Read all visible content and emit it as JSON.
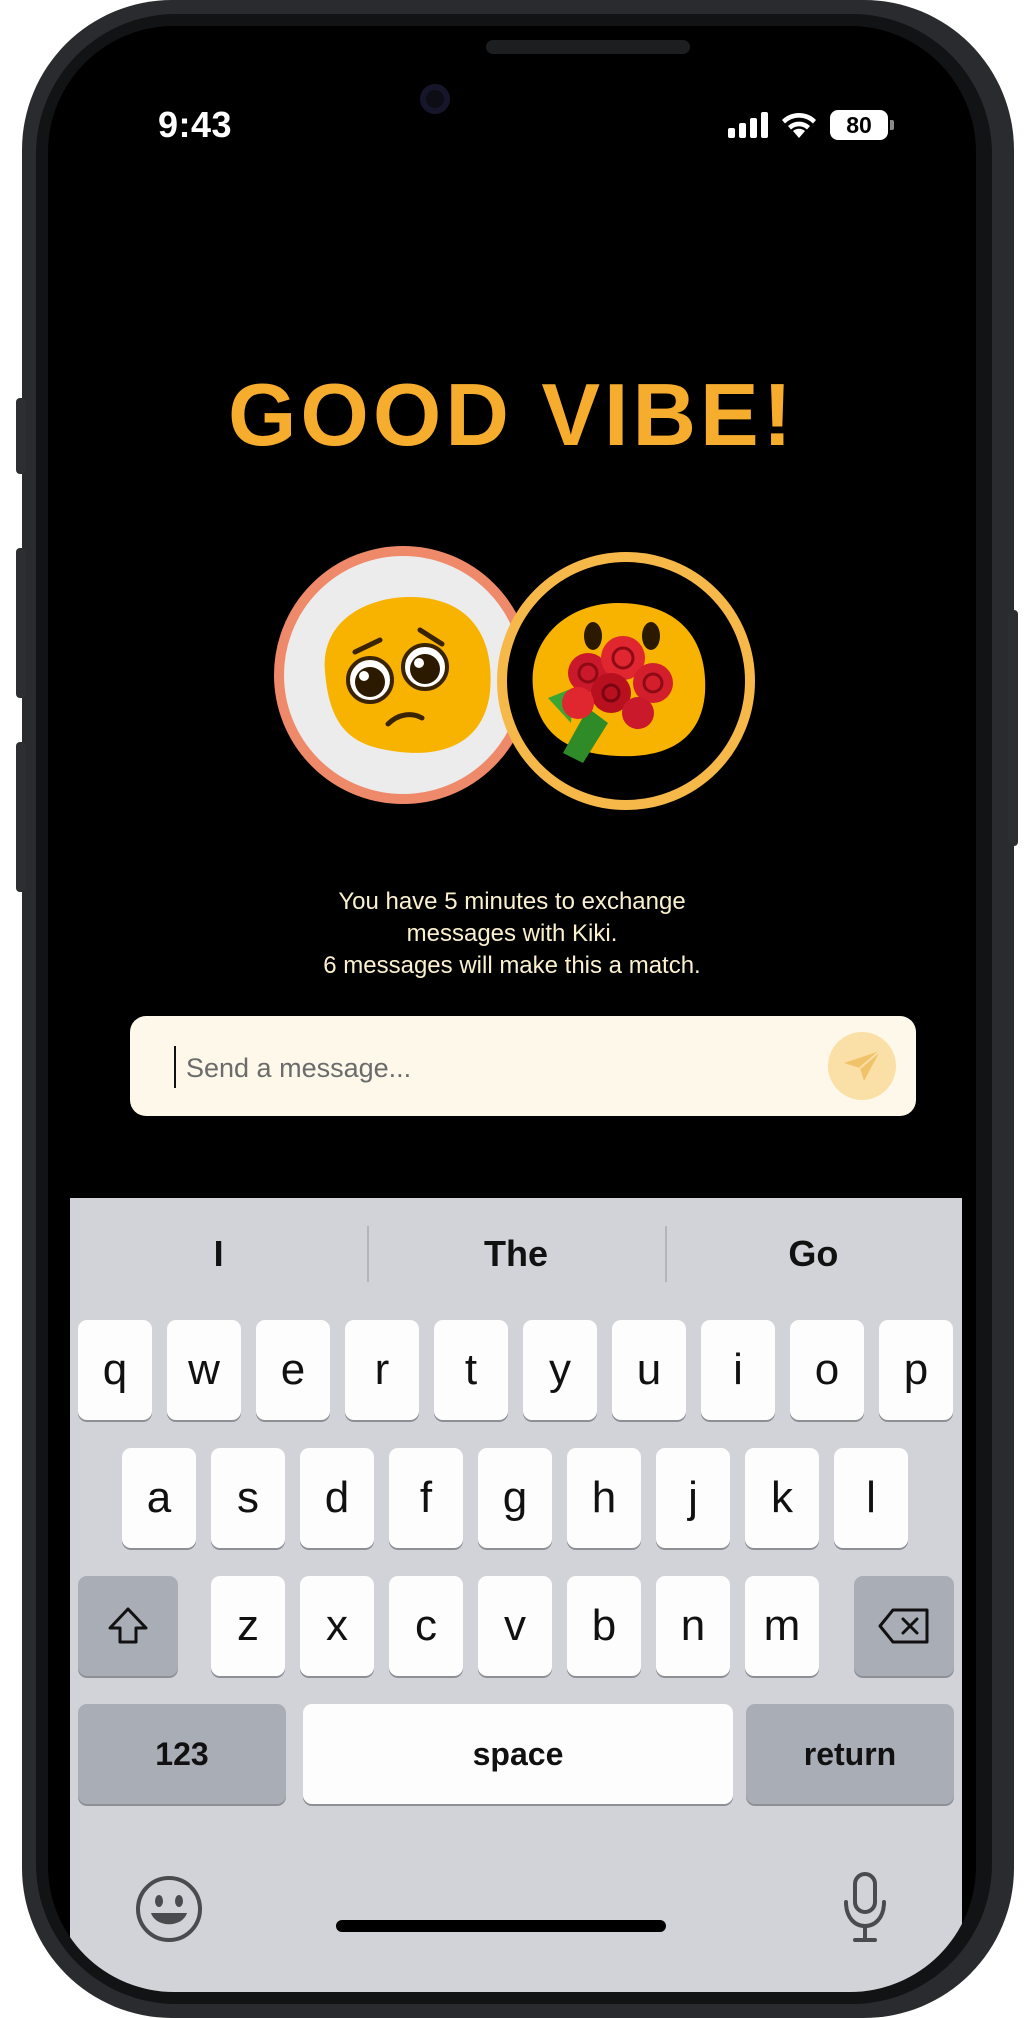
{
  "status_bar": {
    "time": "9:43",
    "battery": "80"
  },
  "screen": {
    "headline": "GOOD VIBE!",
    "info_lines": [
      "You have 5 minutes to exchange",
      "messages with Kiki.",
      "6 messages will make this a match."
    ],
    "composer": {
      "placeholder": "Send a message..."
    }
  },
  "keyboard": {
    "suggestions": [
      "I",
      "The",
      "Go"
    ],
    "row1": [
      "q",
      "w",
      "e",
      "r",
      "t",
      "y",
      "u",
      "i",
      "o",
      "p"
    ],
    "row2": [
      "a",
      "s",
      "d",
      "f",
      "g",
      "h",
      "j",
      "k",
      "l"
    ],
    "row3": [
      "z",
      "x",
      "c",
      "v",
      "b",
      "n",
      "m"
    ],
    "numbers_label": "123",
    "space_label": "space",
    "return_label": "return"
  },
  "colors": {
    "accent": "#f6ad2d",
    "info_text": "#fbf1cf",
    "composer_bg": "#fdf8e9",
    "left_ring": "#ee8a6a",
    "right_ring": "#f7b84a"
  },
  "icons": [
    "shift-icon",
    "backspace-icon",
    "emoji-icon",
    "microphone-icon",
    "send-icon",
    "wifi-icon",
    "signal-icon",
    "battery-icon"
  ]
}
